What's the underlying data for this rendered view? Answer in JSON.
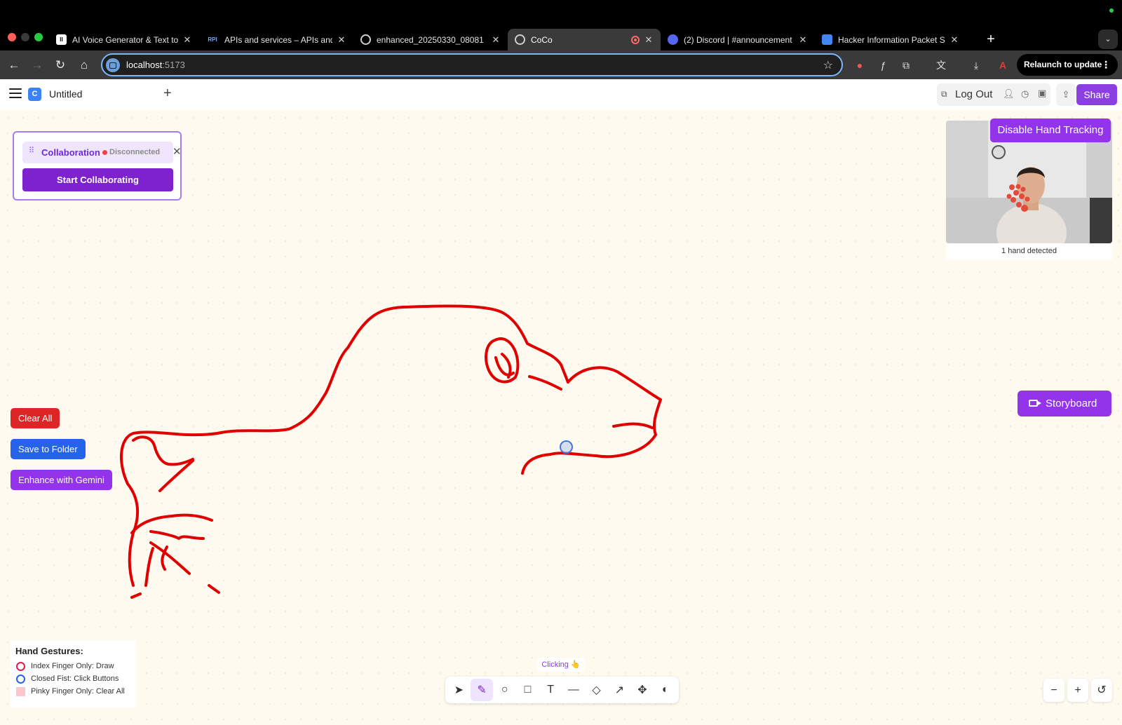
{
  "browser": {
    "tabs": [
      {
        "title": "AI Voice Generator & Text to S",
        "favicon": "elevenlabs-icon",
        "favicon_text": "II",
        "active": false
      },
      {
        "title": "APIs and services – APIs and",
        "favicon": "google-api-icon",
        "favicon_text": "RPI",
        "active": false
      },
      {
        "title": "enhanced_20250330_08081",
        "favicon": "globe-icon",
        "favicon_text": "",
        "active": false
      },
      {
        "title": "CoCo",
        "favicon": "globe-icon",
        "favicon_text": "",
        "active": true,
        "recording": true
      },
      {
        "title": "(2) Discord | #announcement",
        "favicon": "discord-icon",
        "favicon_text": "",
        "active": false
      },
      {
        "title": "Hacker Information Packet Sp",
        "favicon": "google-docs-icon",
        "favicon_text": "",
        "active": false
      }
    ],
    "address": {
      "host": "localhost",
      "port": ":5173"
    },
    "relaunch_label": "Relaunch to update"
  },
  "app": {
    "doc_title": "Untitled",
    "logo_letter": "C",
    "header": {
      "logout_label": "Log Out",
      "share_label": "Share"
    },
    "collaboration": {
      "title": "Collaboration",
      "status": "Disconnected",
      "start_label": "Start Collaborating"
    },
    "side_buttons": {
      "clear_all": "Clear All",
      "save_to_folder": "Save to Folder",
      "enhance": "Enhance with Gemini"
    },
    "camera": {
      "toggle_label": "Disable Hand Tracking",
      "caption": "1 hand detected"
    },
    "storyboard_label": "Storyboard",
    "gestures": {
      "title": "Hand Gestures:",
      "items": [
        {
          "label": "Index Finger Only: Draw",
          "marker": "red-ring"
        },
        {
          "label": "Closed Fist: Click Buttons",
          "marker": "blue-ring"
        },
        {
          "label": "Pinky Finger Only: Clear All",
          "marker": "pink-square"
        }
      ]
    },
    "gesture_status": "Clicking 👆",
    "tools": [
      {
        "name": "select-tool-icon",
        "active": false
      },
      {
        "name": "pen-tool-icon",
        "active": true
      },
      {
        "name": "ellipse-tool-icon",
        "active": false
      },
      {
        "name": "rectangle-tool-icon",
        "active": false
      },
      {
        "name": "text-tool-icon",
        "active": false
      },
      {
        "name": "line-tool-icon",
        "active": false
      },
      {
        "name": "eraser-tool-icon",
        "active": false
      },
      {
        "name": "external-link-icon",
        "active": false
      },
      {
        "name": "move-tool-icon",
        "active": false
      },
      {
        "name": "palette-icon",
        "active": false
      }
    ],
    "stroke_color": "#e00000",
    "accent_color": "#9333ea"
  }
}
